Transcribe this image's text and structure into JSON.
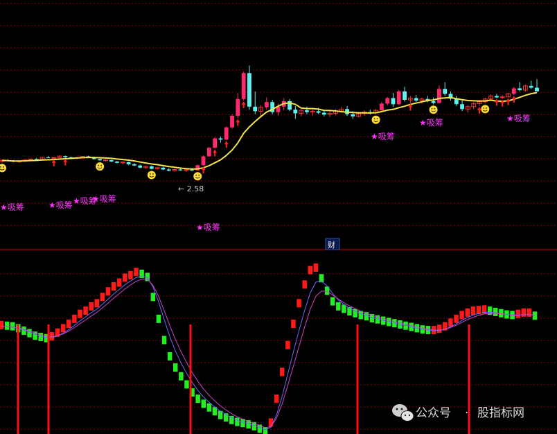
{
  "chart_data": [
    {
      "type": "candlestick",
      "panel": "price",
      "grid": "dotted horizontal, red",
      "candles": [
        [
          2.9,
          2.96,
          2.87,
          2.94
        ],
        [
          2.94,
          2.97,
          2.91,
          2.92
        ],
        [
          2.92,
          2.95,
          2.88,
          2.89
        ],
        [
          2.89,
          2.93,
          2.86,
          2.91
        ],
        [
          2.91,
          2.96,
          2.89,
          2.95
        ],
        [
          2.95,
          3.0,
          2.93,
          2.98
        ],
        [
          2.98,
          3.02,
          2.95,
          2.97
        ],
        [
          2.97,
          3.05,
          2.96,
          3.04
        ],
        [
          3.04,
          3.08,
          3.01,
          3.02
        ],
        [
          3.02,
          3.05,
          2.99,
          3.03
        ],
        [
          3.03,
          3.1,
          3.01,
          3.08
        ],
        [
          3.08,
          3.09,
          3.02,
          3.04
        ],
        [
          3.04,
          3.06,
          2.99,
          3.01
        ],
        [
          3.01,
          3.05,
          2.98,
          3.03
        ],
        [
          3.03,
          3.08,
          3.02,
          3.07
        ],
        [
          3.07,
          3.09,
          3.02,
          3.04
        ],
        [
          3.04,
          3.05,
          2.96,
          2.98
        ],
        [
          2.98,
          3.0,
          2.92,
          2.94
        ],
        [
          2.94,
          2.97,
          2.9,
          2.95
        ],
        [
          2.95,
          2.96,
          2.88,
          2.9
        ],
        [
          2.9,
          2.92,
          2.84,
          2.86
        ],
        [
          2.86,
          2.9,
          2.83,
          2.88
        ],
        [
          2.88,
          2.89,
          2.79,
          2.81
        ],
        [
          2.81,
          2.85,
          2.75,
          2.77
        ],
        [
          2.77,
          2.8,
          2.68,
          2.7
        ],
        [
          2.7,
          2.76,
          2.66,
          2.74
        ],
        [
          2.74,
          2.77,
          2.64,
          2.66
        ],
        [
          2.66,
          2.72,
          2.63,
          2.7
        ],
        [
          2.7,
          2.73,
          2.62,
          2.64
        ],
        [
          2.64,
          2.68,
          2.58,
          2.6
        ],
        [
          2.6,
          2.66,
          2.57,
          2.64
        ],
        [
          2.64,
          2.7,
          2.6,
          2.61
        ],
        [
          2.61,
          2.66,
          2.56,
          2.63
        ],
        [
          2.63,
          2.69,
          2.58,
          2.61
        ],
        [
          2.61,
          2.8,
          2.6,
          2.78
        ],
        [
          2.78,
          3.1,
          2.76,
          3.07
        ],
        [
          3.07,
          3.38,
          3.05,
          3.35
        ],
        [
          3.35,
          3.7,
          3.32,
          3.66
        ],
        [
          3.66,
          3.72,
          3.52,
          3.62
        ],
        [
          3.62,
          4.05,
          3.6,
          4.02
        ],
        [
          4.02,
          4.45,
          3.98,
          4.4
        ],
        [
          4.4,
          5.15,
          4.32,
          4.95
        ],
        [
          4.95,
          5.85,
          4.9,
          5.8
        ],
        [
          5.8,
          6.05,
          4.6,
          4.7
        ],
        [
          4.7,
          5.2,
          4.45,
          4.55
        ],
        [
          4.55,
          4.75,
          4.35,
          4.68
        ],
        [
          4.68,
          5.0,
          4.6,
          4.85
        ],
        [
          4.85,
          4.92,
          4.45,
          4.52
        ],
        [
          4.52,
          4.8,
          4.4,
          4.7
        ],
        [
          4.7,
          4.98,
          4.58,
          4.88
        ],
        [
          4.88,
          4.95,
          4.55,
          4.6
        ],
        [
          4.6,
          4.72,
          4.3,
          4.48
        ],
        [
          4.48,
          4.62,
          4.38,
          4.58
        ],
        [
          4.58,
          4.7,
          4.45,
          4.52
        ],
        [
          4.52,
          4.6,
          4.4,
          4.55
        ],
        [
          4.55,
          4.66,
          4.46,
          4.5
        ],
        [
          4.5,
          4.58,
          4.38,
          4.44
        ],
        [
          4.44,
          4.55,
          4.36,
          4.48
        ],
        [
          4.48,
          4.62,
          4.42,
          4.56
        ],
        [
          4.56,
          4.7,
          4.5,
          4.62
        ],
        [
          4.62,
          4.72,
          4.4,
          4.45
        ],
        [
          4.45,
          4.55,
          4.3,
          4.38
        ],
        [
          4.38,
          4.5,
          4.34,
          4.47
        ],
        [
          4.47,
          4.58,
          4.4,
          4.52
        ],
        [
          4.52,
          4.6,
          4.44,
          4.5
        ],
        [
          4.5,
          4.62,
          4.45,
          4.58
        ],
        [
          4.58,
          4.85,
          4.55,
          4.8
        ],
        [
          4.8,
          5.02,
          4.74,
          4.98
        ],
        [
          4.98,
          5.15,
          4.7,
          4.78
        ],
        [
          4.78,
          5.25,
          4.75,
          5.2
        ],
        [
          5.2,
          5.35,
          4.86,
          4.92
        ],
        [
          4.92,
          5.05,
          4.82,
          4.98
        ],
        [
          4.98,
          5.08,
          4.85,
          4.9
        ],
        [
          4.9,
          5.0,
          4.8,
          4.95
        ],
        [
          4.95,
          5.05,
          4.84,
          4.88
        ],
        [
          4.88,
          5.0,
          4.78,
          4.82
        ],
        [
          4.82,
          5.4,
          4.8,
          5.28
        ],
        [
          5.28,
          5.5,
          5.05,
          5.12
        ],
        [
          5.12,
          5.2,
          4.9,
          4.96
        ],
        [
          4.96,
          5.05,
          4.72,
          4.78
        ],
        [
          4.78,
          4.9,
          4.55,
          4.62
        ],
        [
          4.62,
          4.75,
          4.5,
          4.7
        ],
        [
          4.7,
          4.85,
          4.62,
          4.8
        ],
        [
          4.8,
          4.92,
          4.72,
          4.86
        ],
        [
          4.86,
          5.0,
          4.8,
          4.95
        ],
        [
          4.95,
          5.1,
          4.9,
          5.05
        ],
        [
          5.05,
          5.12,
          4.98,
          5.0
        ],
        [
          5.0,
          5.08,
          4.95,
          5.02
        ],
        [
          5.02,
          5.15,
          5.0,
          5.12
        ],
        [
          5.12,
          5.35,
          5.08,
          5.3
        ],
        [
          5.3,
          5.5,
          5.2,
          5.24
        ],
        [
          5.24,
          5.42,
          5.18,
          5.38
        ],
        [
          5.38,
          5.55,
          5.28,
          5.32
        ],
        [
          5.32,
          5.6,
          5.28,
          5.2
        ]
      ],
      "yellow_line": "moving average (values computed from closes)",
      "markers": [
        {
          "label": "吸筹"
        },
        {
          "label": "吸筹"
        },
        {
          "label": "吸筹"
        },
        {
          "label": "吸筹"
        },
        {
          "label": "吸筹"
        },
        {
          "label": "吸筹"
        },
        {
          "label": "吸筹"
        },
        {
          "label": "吸筹"
        }
      ],
      "annotations": [
        {
          "text": "2.58"
        }
      ]
    },
    {
      "type": "bar",
      "panel": "indicator",
      "series_colors": {
        "rising": "#ff1a1a",
        "falling": "#22ee22"
      },
      "values": [
        10,
        9,
        8,
        5,
        1,
        -3,
        -7,
        -9,
        -11,
        -8,
        -2,
        5,
        12,
        20,
        28,
        33,
        40,
        45,
        55,
        64,
        72,
        78,
        86,
        90,
        95,
        92,
        87,
        55,
        20,
        -14,
        -40,
        -58,
        -72,
        -85,
        -98,
        -108,
        -116,
        -122,
        -128,
        -134,
        -138,
        -142,
        -145,
        -147,
        -149,
        -152,
        -156,
        -160,
        -146,
        -108,
        -65,
        -22,
        12,
        45,
        75,
        98,
        102,
        85,
        65,
        48,
        40,
        36,
        32,
        29,
        26,
        24,
        21,
        19,
        17,
        15,
        13,
        11,
        9,
        7,
        5,
        3,
        2,
        2,
        4,
        8,
        14,
        20,
        26,
        30,
        33,
        34,
        35,
        33,
        31,
        29,
        27,
        26,
        28,
        30,
        30,
        25
      ],
      "signal_lines": [
        {
          "name": "",
          "color": "#6a6aff"
        },
        {
          "name": "",
          "color": "#cc44cc"
        }
      ],
      "markers_x_index": [
        5,
        16,
        62,
        117,
        153
      ]
    }
  ],
  "header": {
    "divider_label": "财"
  },
  "watermark": {
    "prefix": "公众号",
    "separator": "·",
    "name": "股指标网"
  },
  "colors": {
    "background": "#000000",
    "up": "#ff2a6d",
    "up_small": "#ff3030",
    "down": "#5ff0f0",
    "ma": "#f2e64a",
    "grid": "#8a0000",
    "label": "#ff33ff",
    "smiley": "#ffdd33",
    "arrow": "#ff2020"
  }
}
